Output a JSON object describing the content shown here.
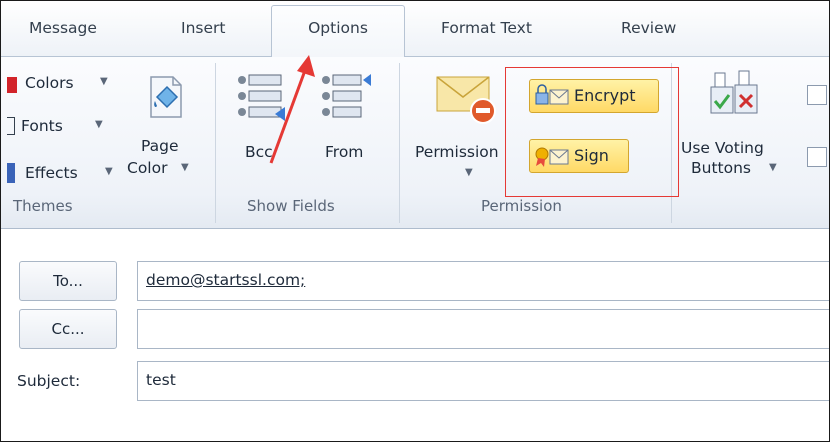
{
  "tabs": [
    {
      "label": "Message"
    },
    {
      "label": "Insert"
    },
    {
      "label": "Options",
      "active": true
    },
    {
      "label": "Format Text"
    },
    {
      "label": "Review"
    }
  ],
  "themes": {
    "colors_label": "Colors",
    "fonts_label": "Fonts",
    "effects_label": "Effects",
    "page_label": "Page",
    "color_label": "Color",
    "group_label": "Themes"
  },
  "show_fields": {
    "bcc_label": "Bcc",
    "from_label": "From",
    "group_label": "Show Fields"
  },
  "permission": {
    "permission_label": "Permission",
    "encrypt_label": "Encrypt",
    "sign_label": "Sign",
    "group_label": "Permission"
  },
  "voting": {
    "use_voting_label": "Use Voting",
    "buttons_label": "Buttons"
  },
  "compose": {
    "to_label": "To...",
    "to_value": "demo@startssl.com;",
    "cc_label": "Cc...",
    "cc_value": "",
    "subject_label": "Subject:",
    "subject_value": "test"
  },
  "colors": {
    "highlight_box": "#e53935",
    "button_yellow": "#ffd966",
    "arrow": "#e53935"
  }
}
